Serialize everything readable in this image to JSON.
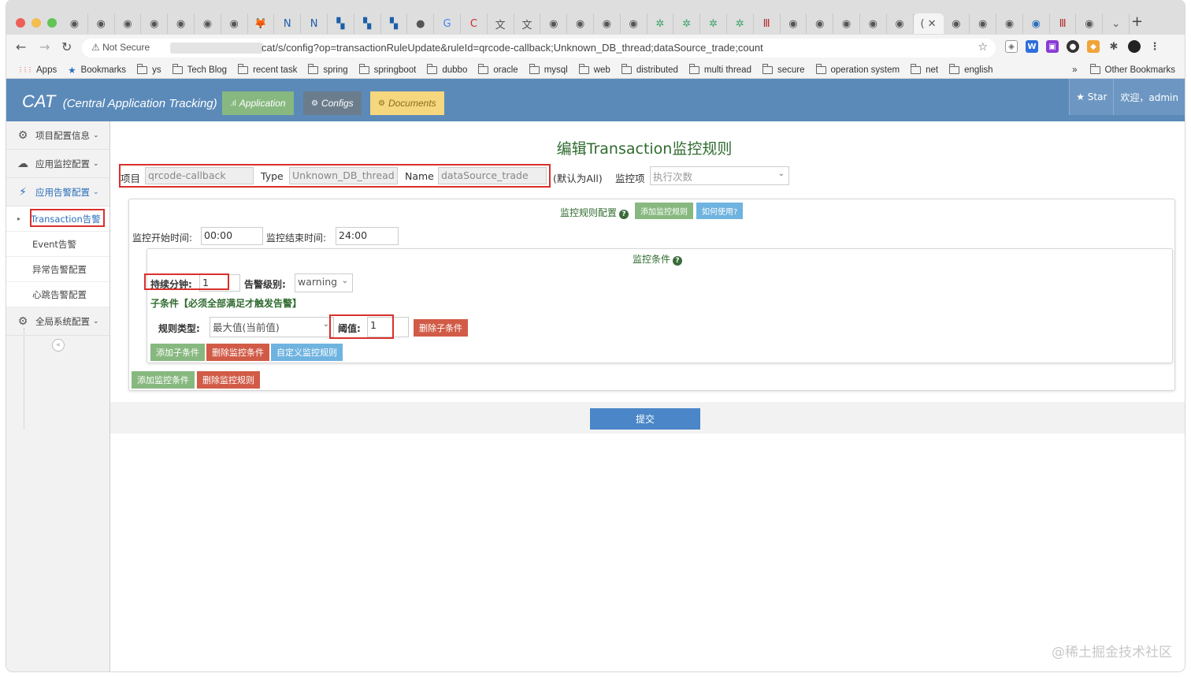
{
  "browser": {
    "tabs": [
      {
        "icon": "globe-icon",
        "char": "◉"
      },
      {
        "icon": "globe-icon",
        "char": "◉"
      },
      {
        "icon": "globe-icon",
        "char": "◉"
      },
      {
        "icon": "globe-icon",
        "char": "◉"
      },
      {
        "icon": "globe-icon",
        "char": "◉"
      },
      {
        "icon": "globe-icon",
        "char": "◉"
      },
      {
        "icon": "globe-icon",
        "char": "◉"
      },
      {
        "icon": "gitlab-icon",
        "char": "🦊"
      },
      {
        "icon": "nexus-icon",
        "char": "N"
      },
      {
        "icon": "nexus-icon",
        "char": "N"
      },
      {
        "icon": "docker-icon",
        "char": "▚"
      },
      {
        "icon": "docker-icon",
        "char": "▚"
      },
      {
        "icon": "docker-icon",
        "char": "▚"
      },
      {
        "icon": "github-icon",
        "char": "●"
      },
      {
        "icon": "google-icon",
        "char": "G"
      },
      {
        "icon": "csdn-icon",
        "char": "C"
      },
      {
        "icon": "translate-icon",
        "char": "文"
      },
      {
        "icon": "translate-icon",
        "char": "文"
      },
      {
        "icon": "globe-icon",
        "char": "◉"
      },
      {
        "icon": "globe-icon",
        "char": "◉"
      },
      {
        "icon": "globe-icon",
        "char": "◉"
      },
      {
        "icon": "globe-icon",
        "char": "◉"
      },
      {
        "icon": "gear-icon",
        "char": "✲"
      },
      {
        "icon": "gear-icon",
        "char": "✲"
      },
      {
        "icon": "gear-icon",
        "char": "✲"
      },
      {
        "icon": "gear-icon",
        "char": "✲"
      },
      {
        "icon": "bookmark-red-icon",
        "char": "Ⅲ"
      },
      {
        "icon": "globe-icon",
        "char": "◉"
      },
      {
        "icon": "globe-icon",
        "char": "◉"
      },
      {
        "icon": "globe-icon",
        "char": "◉"
      },
      {
        "icon": "globe-icon",
        "char": "◉"
      },
      {
        "icon": "globe-icon",
        "char": "◉"
      },
      {
        "icon": "active-tab",
        "char": "( ✕"
      },
      {
        "icon": "globe-icon",
        "char": "◉"
      },
      {
        "icon": "globe-icon",
        "char": "◉"
      },
      {
        "icon": "globe-icon",
        "char": "◉"
      },
      {
        "icon": "globe-blue-icon",
        "char": "◉"
      },
      {
        "icon": "bookmark-red-icon",
        "char": "Ⅲ"
      },
      {
        "icon": "globe-icon",
        "char": "◉"
      },
      {
        "icon": "chevron-icon",
        "char": "⌄"
      }
    ],
    "new_tab": "+",
    "security": "⚠ Not Secure",
    "url": "cat/s/config?op=transactionRuleUpdate&ruleId=qrcode-callback;Unknown_DB_thread;dataSource_trade;count",
    "bookmarks": [
      "Apps",
      "Bookmarks",
      "ys",
      "Tech Blog",
      "recent task",
      "spring",
      "springboot",
      "dubbo",
      "oracle",
      "mysql",
      "web",
      "distributed",
      "multi thread",
      "secure",
      "operation system",
      "net",
      "english"
    ],
    "bookmarks_more": "»",
    "other_bookmarks": "Other Bookmarks"
  },
  "header": {
    "brand": "CAT",
    "subtitle": "(Central Application Tracking)",
    "nav": [
      {
        "label": "Application",
        "icon": ".ıl",
        "bg": "#87b87f",
        "color": "#fff"
      },
      {
        "label": "Configs",
        "icon": "⚙",
        "bg": "#6b7d8d",
        "color": "#fff"
      },
      {
        "label": "Documents",
        "icon": "⚙",
        "bg": "#f5d77e",
        "color": "#8a6d1f"
      }
    ],
    "star": "★ Star",
    "welcome": "欢迎，admin"
  },
  "sidebar": {
    "items": [
      {
        "label": "项目配置信息",
        "icon": "⚙"
      },
      {
        "label": "应用监控配置",
        "icon": "☁"
      },
      {
        "label": "应用告警配置",
        "icon": "⚡"
      }
    ],
    "subitems": [
      "Transaction告警",
      "Event告警",
      "异常告警配置",
      "心跳告警配置"
    ],
    "global": {
      "label": "全局系统配置",
      "icon": "⚙"
    },
    "collapse": "«"
  },
  "main": {
    "title": "编辑Transaction监控规则",
    "project_label": "项目",
    "project_value": "qrcode-callback",
    "type_label": "Type",
    "type_value": "Unknown_DB_thread",
    "name_label": "Name",
    "name_value": "dataSource_trade",
    "default_note": "(默认为All)",
    "monitor_item_label": "监控项",
    "monitor_item_value": "执行次数",
    "rule_config_label": "监控规则配置",
    "add_rule": "添加监控规则",
    "how_to_use": "如何使用?",
    "start_time_label": "监控开始时间:",
    "start_time": "00:00",
    "end_time_label": "监控结束时间:",
    "end_time": "24:00",
    "condition_label": "监控条件",
    "duration_label": "持续分钟:",
    "duration_value": "1",
    "alert_level_label": "告警级别:",
    "alert_level_value": "warning",
    "subcondition_note": "子条件【必须全部满足才触发告警】",
    "rule_type_label": "规则类型:",
    "rule_type_value": "最大值(当前值)",
    "threshold_label": "阈值:",
    "threshold_value": "1",
    "delete_subcondition": "删除子条件",
    "add_subcondition": "添加子条件",
    "delete_condition": "删除监控条件",
    "custom_rule": "自定义监控规则",
    "add_condition": "添加监控条件",
    "delete_rule": "删除监控规则",
    "submit": "提交",
    "watermark": "@稀土掘金技术社区"
  }
}
